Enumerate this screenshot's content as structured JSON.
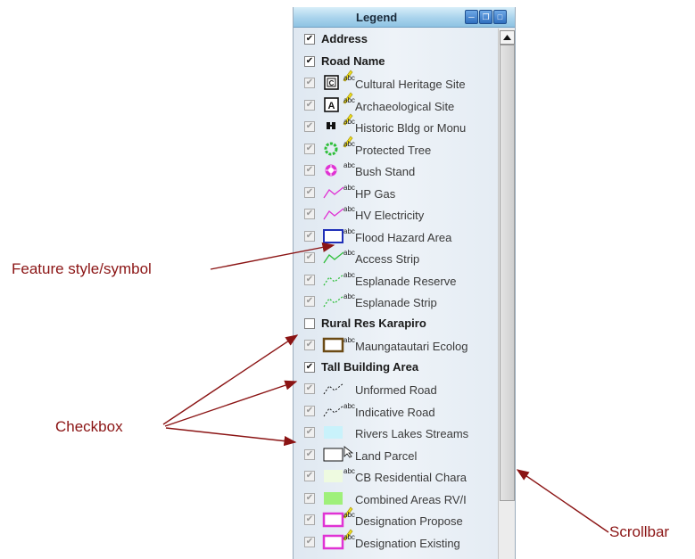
{
  "legend": {
    "title": "Legend",
    "rows": [
      {
        "kind": "layer",
        "label": "Address",
        "checked": true
      },
      {
        "kind": "layer",
        "label": "Road Name",
        "checked": true
      },
      {
        "kind": "item",
        "label": "Cultural Heritage Site",
        "symbol": "c-box-icon",
        "abc": true,
        "pencil": true
      },
      {
        "kind": "item",
        "label": "Archaeological Site",
        "symbol": "a-box-icon",
        "abc": true,
        "pencil": true
      },
      {
        "kind": "item",
        "label": "Historic Bldg or Monu",
        "symbol": "building-icon",
        "abc": true,
        "pencil": true
      },
      {
        "kind": "item",
        "label": "Protected Tree",
        "symbol": "tree-circle-icon",
        "abc": true,
        "pencil": true
      },
      {
        "kind": "item",
        "label": "Bush Stand",
        "symbol": "magenta-flower-icon",
        "abc": true
      },
      {
        "kind": "item",
        "label": "HP Gas",
        "symbol": "magenta-line-icon",
        "abc": true
      },
      {
        "kind": "item",
        "label": "HV Electricity",
        "symbol": "magenta-line-icon",
        "abc": true
      },
      {
        "kind": "item",
        "label": "Flood Hazard Area",
        "symbol": "blue-box-icon",
        "abc": true
      },
      {
        "kind": "item",
        "label": "Access Strip",
        "symbol": "green-line-icon",
        "abc": true
      },
      {
        "kind": "item",
        "label": "Esplanade Reserve",
        "symbol": "green-dashed-line-icon",
        "abc": true
      },
      {
        "kind": "item",
        "label": "Esplanade Strip",
        "symbol": "green-dashed-line-icon",
        "abc": true
      },
      {
        "kind": "layer",
        "label": "Rural Res Karapiro",
        "checked": false
      },
      {
        "kind": "item",
        "label": "Maungatautari Ecolog",
        "symbol": "brown-box-icon",
        "abc": true
      },
      {
        "kind": "layer",
        "label": "Tall Building Area",
        "checked": true
      },
      {
        "kind": "item",
        "label": "Unformed Road",
        "symbol": "black-dashed-line-icon",
        "abc": false
      },
      {
        "kind": "item",
        "label": "Indicative Road",
        "symbol": "black-dashed-line-icon",
        "abc": true
      },
      {
        "kind": "item",
        "label": "Rivers Lakes Streams",
        "symbol": "light-blue-fill-icon",
        "abc": false
      },
      {
        "kind": "item",
        "label": "Land Parcel",
        "symbol": "white-box-icon",
        "abc": false,
        "cursor": true
      },
      {
        "kind": "item",
        "label": "CB Residential Chara",
        "symbol": "pale-fill-icon",
        "abc": true
      },
      {
        "kind": "item",
        "label": "Combined Areas RV/I",
        "symbol": "green-fill-icon",
        "abc": false
      },
      {
        "kind": "item",
        "label": "Designation Propose",
        "symbol": "magenta-box-icon",
        "abc": true,
        "pencil": true
      },
      {
        "kind": "item",
        "label": "Designation Existing",
        "symbol": "magenta-box-icon",
        "abc": true,
        "pencil": true
      }
    ]
  },
  "callouts": {
    "feature": "Feature style/symbol",
    "checkbox": "Checkbox",
    "scrollbar": "Scrollbar"
  },
  "colors": {
    "callout": "#8b1414",
    "magenta": "#e033d4",
    "green": "#2fbf3a",
    "blue": "#1f2fb8",
    "brown": "#6b4a14"
  }
}
